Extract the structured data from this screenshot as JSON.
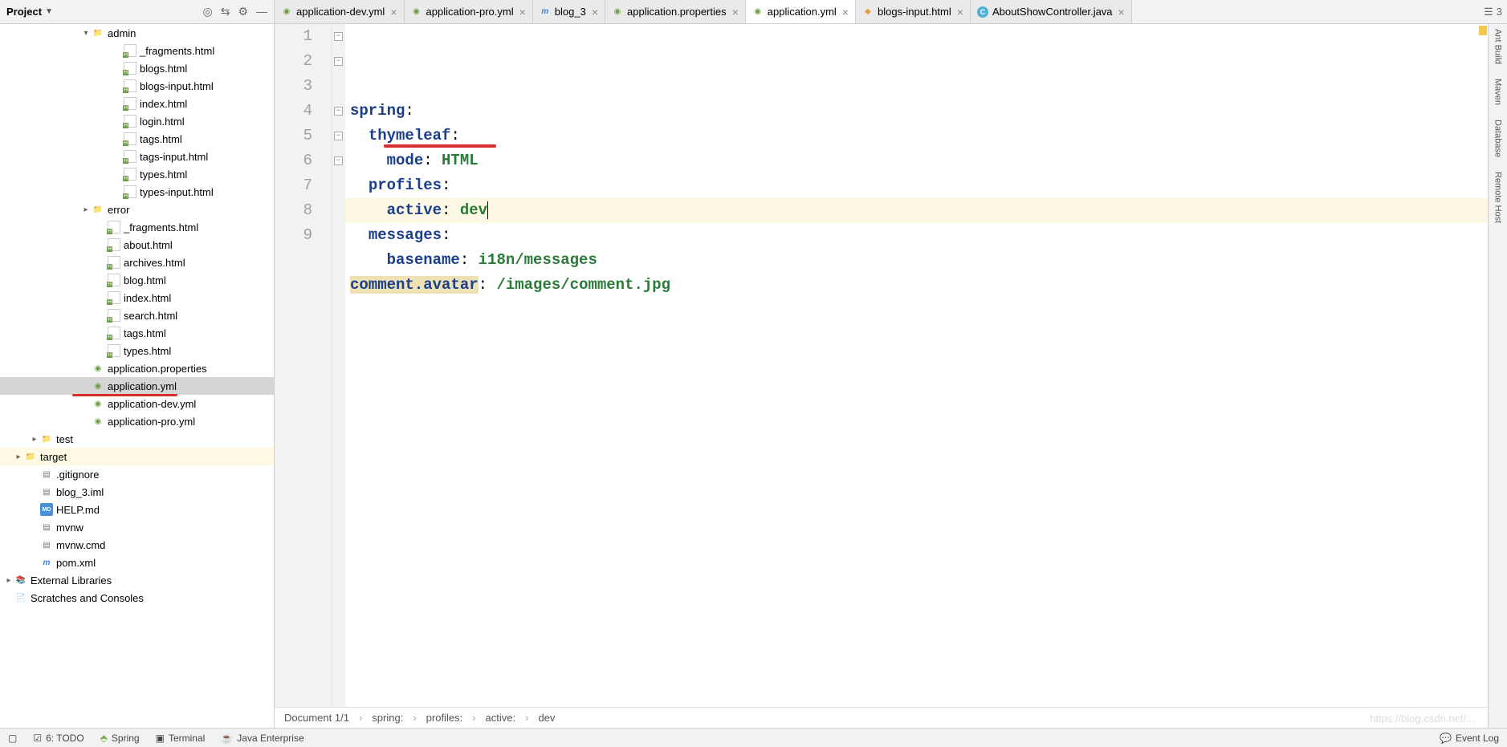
{
  "project_label": "Project",
  "tabs": [
    {
      "icon": "yml",
      "label": "application-dev.yml"
    },
    {
      "icon": "yml",
      "label": "application-pro.yml"
    },
    {
      "icon": "blog",
      "label": "blog_3"
    },
    {
      "icon": "props",
      "label": "application.properties"
    },
    {
      "icon": "yml",
      "label": "application.yml",
      "active": true
    },
    {
      "icon": "html",
      "label": "blogs-input.html"
    },
    {
      "icon": "java",
      "label": "AboutShowController.java"
    }
  ],
  "tabs_overflow_count": "3",
  "tree": [
    {
      "indent": 100,
      "chev": "down",
      "icon": "folder",
      "label": "admin"
    },
    {
      "indent": 140,
      "icon": "html",
      "label": "_fragments.html"
    },
    {
      "indent": 140,
      "icon": "html",
      "label": "blogs.html"
    },
    {
      "indent": 140,
      "icon": "html",
      "label": "blogs-input.html"
    },
    {
      "indent": 140,
      "icon": "html",
      "label": "index.html"
    },
    {
      "indent": 140,
      "icon": "html",
      "label": "login.html"
    },
    {
      "indent": 140,
      "icon": "html",
      "label": "tags.html"
    },
    {
      "indent": 140,
      "icon": "html",
      "label": "tags-input.html"
    },
    {
      "indent": 140,
      "icon": "html",
      "label": "types.html"
    },
    {
      "indent": 140,
      "icon": "html",
      "label": "types-input.html"
    },
    {
      "indent": 100,
      "chev": "right",
      "icon": "folder",
      "label": "error"
    },
    {
      "indent": 120,
      "icon": "html",
      "label": "_fragments.html"
    },
    {
      "indent": 120,
      "icon": "html",
      "label": "about.html"
    },
    {
      "indent": 120,
      "icon": "html",
      "label": "archives.html"
    },
    {
      "indent": 120,
      "icon": "html",
      "label": "blog.html"
    },
    {
      "indent": 120,
      "icon": "html",
      "label": "index.html"
    },
    {
      "indent": 120,
      "icon": "html",
      "label": "search.html"
    },
    {
      "indent": 120,
      "icon": "html",
      "label": "tags.html"
    },
    {
      "indent": 120,
      "icon": "html",
      "label": "types.html"
    },
    {
      "indent": 100,
      "icon": "props",
      "label": "application.properties"
    },
    {
      "indent": 100,
      "icon": "yml",
      "label": "application.yml",
      "selected": true,
      "red": true
    },
    {
      "indent": 100,
      "icon": "yml",
      "label": "application-dev.yml"
    },
    {
      "indent": 100,
      "icon": "yml",
      "label": "application-pro.yml"
    },
    {
      "indent": 36,
      "chev": "right",
      "icon": "folder",
      "label": "test"
    },
    {
      "indent": 16,
      "chev": "right",
      "icon": "folder-orange",
      "label": "target",
      "highlight": true
    },
    {
      "indent": 36,
      "icon": "file",
      "label": ".gitignore"
    },
    {
      "indent": 36,
      "icon": "file",
      "label": "blog_3.iml"
    },
    {
      "indent": 36,
      "icon": "md",
      "label": "HELP.md"
    },
    {
      "indent": 36,
      "icon": "file",
      "label": "mvnw"
    },
    {
      "indent": 36,
      "icon": "file",
      "label": "mvnw.cmd"
    },
    {
      "indent": 36,
      "icon": "blog",
      "label": "pom.xml"
    },
    {
      "indent": 4,
      "chev": "right",
      "icon": "lib",
      "label": "External Libraries"
    },
    {
      "indent": 4,
      "chev": "blank",
      "icon": "scratch",
      "label": "Scratches and Consoles"
    }
  ],
  "code": {
    "lines": [
      {
        "n": "1",
        "seg": [
          {
            "t": "spring",
            "c": "k-key"
          },
          {
            "t": ":",
            "c": ""
          }
        ]
      },
      {
        "n": "2",
        "seg": [
          {
            "t": "  "
          },
          {
            "t": "thymeleaf",
            "c": "k-key"
          },
          {
            "t": ":"
          }
        ]
      },
      {
        "n": "3",
        "seg": [
          {
            "t": "    "
          },
          {
            "t": "mode",
            "c": "k-key"
          },
          {
            "t": ": "
          },
          {
            "t": "HTML",
            "c": "k-val"
          }
        ]
      },
      {
        "n": "4",
        "seg": [
          {
            "t": "  "
          },
          {
            "t": "profiles",
            "c": "k-key"
          },
          {
            "t": ":"
          }
        ]
      },
      {
        "n": "5",
        "hl": true,
        "seg": [
          {
            "t": "    "
          },
          {
            "t": "active",
            "c": "k-key"
          },
          {
            "t": ": "
          },
          {
            "t": "dev",
            "c": "k-val"
          }
        ],
        "cursor": true,
        "red": true
      },
      {
        "n": "6",
        "seg": [
          {
            "t": "  "
          },
          {
            "t": "messages",
            "c": "k-key"
          },
          {
            "t": ":"
          }
        ]
      },
      {
        "n": "7",
        "seg": [
          {
            "t": "    "
          },
          {
            "t": "basename",
            "c": "k-key"
          },
          {
            "t": ": "
          },
          {
            "t": "i18n/messages",
            "c": "k-val"
          }
        ]
      },
      {
        "n": "8",
        "seg": [
          {
            "t": "comment.avatar",
            "c": "k-key k-bg"
          },
          {
            "t": ": "
          },
          {
            "t": "/images/comment.jpg",
            "c": "k-val"
          }
        ]
      },
      {
        "n": "9",
        "seg": []
      }
    ]
  },
  "breadcrumb": [
    "Document 1/1",
    "spring:",
    "profiles:",
    "active:",
    "dev"
  ],
  "right_tools": [
    "Ant Build",
    "Maven",
    "Database",
    "Remote Host"
  ],
  "bottom": {
    "todo": "6: TODO",
    "spring": "Spring",
    "terminal": "Terminal",
    "java_ee": "Java Enterprise",
    "event_log": "Event Log"
  },
  "watermark": "https://blog.csdn.net/..."
}
